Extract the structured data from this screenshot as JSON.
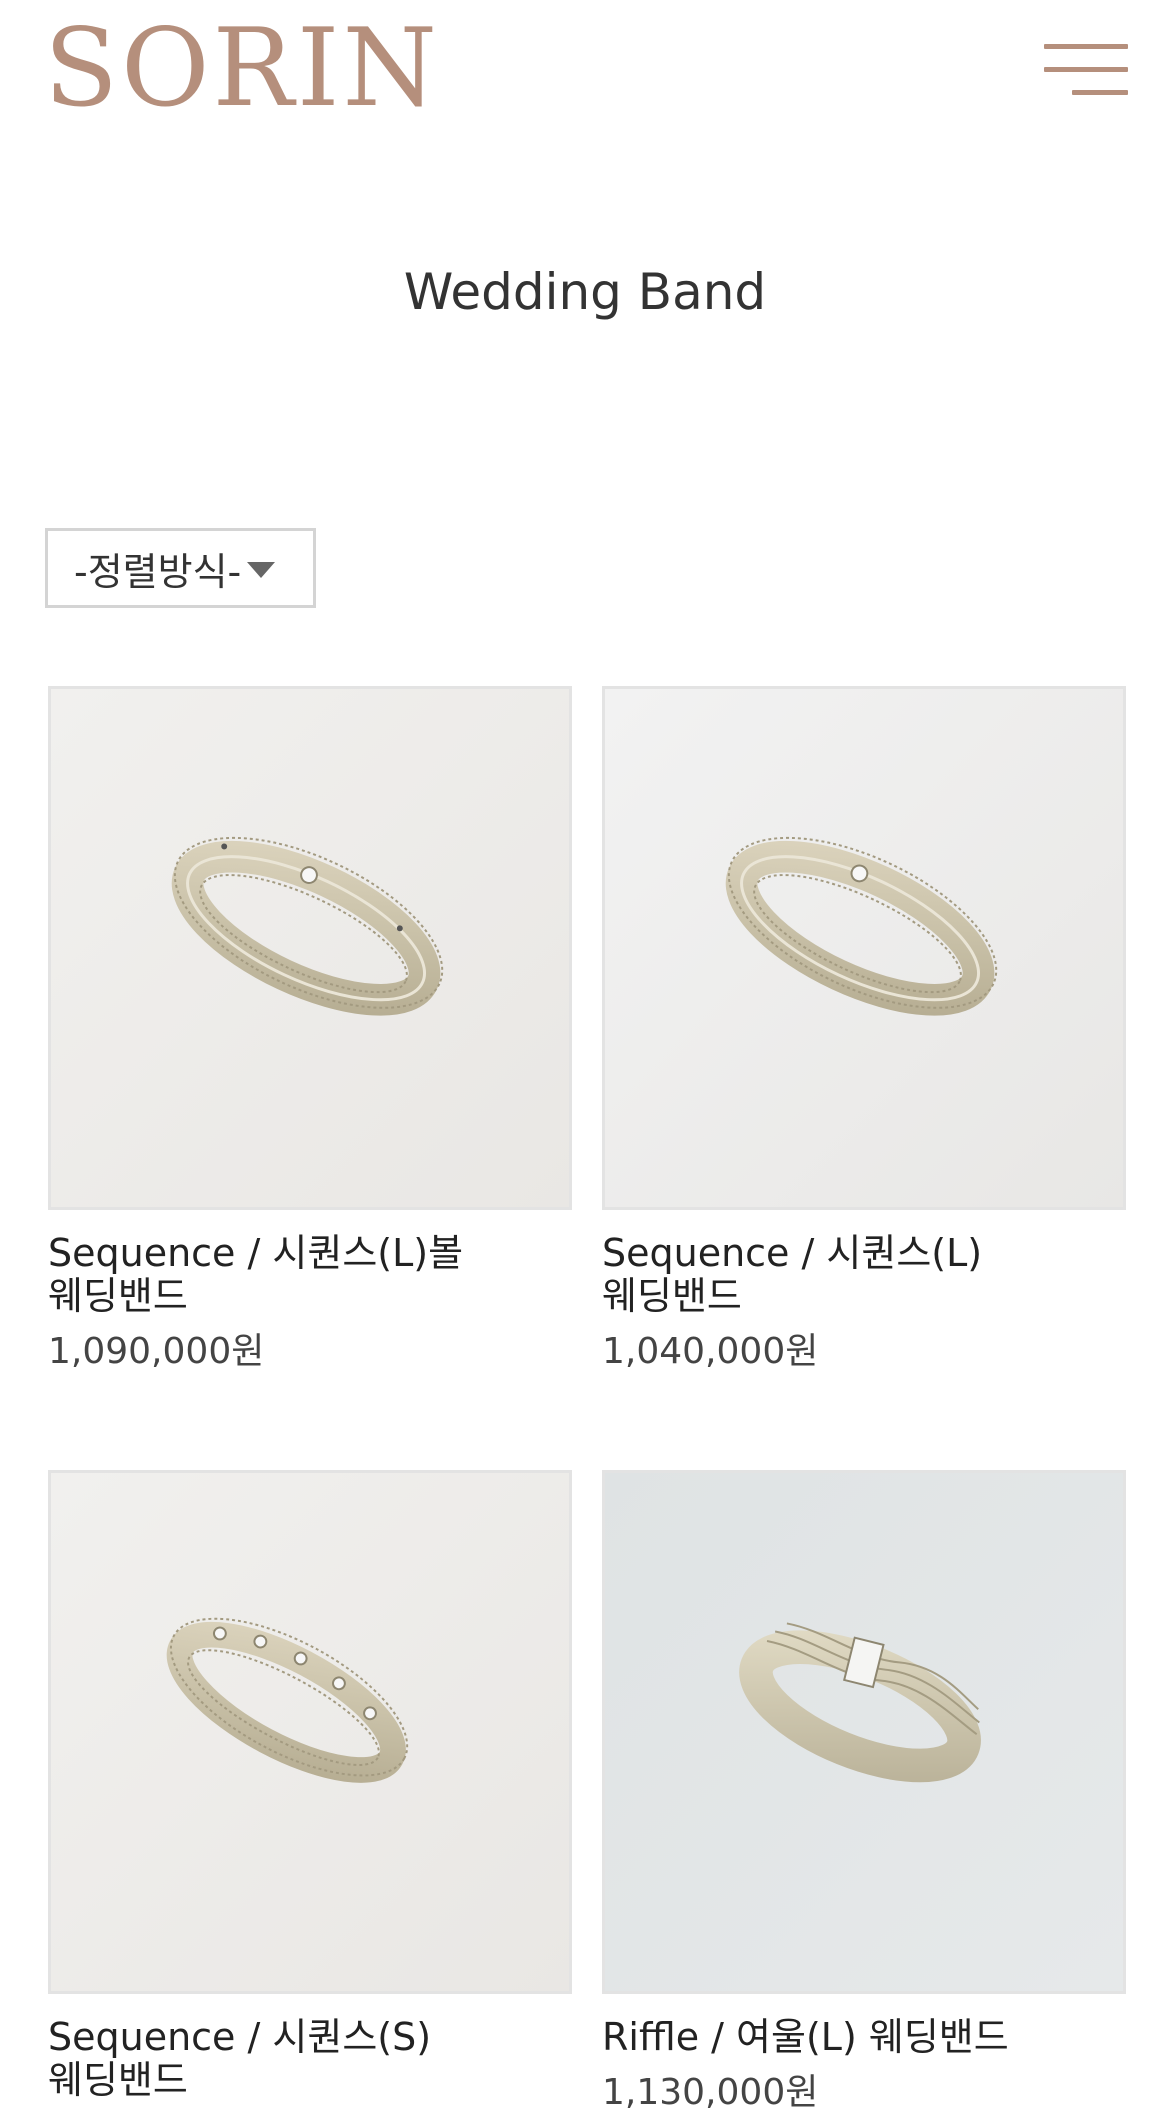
{
  "header": {
    "logo": "SORIN",
    "menu_icon": "hamburger-menu-icon"
  },
  "page_title": "Wedding Band",
  "sort": {
    "label": "-정렬방식-"
  },
  "products": [
    {
      "name": "Sequence / 시퀀스(L)볼 웨딩밴드",
      "price": "1,090,000원"
    },
    {
      "name": "Sequence / 시퀀스(L) 웨딩밴드",
      "price": "1,040,000원"
    },
    {
      "name": "Sequence / 시퀀스(S) 웨딩밴드",
      "price": ""
    },
    {
      "name": "Riffle / 여울(L) 웨딩밴드",
      "price": "1,130,000원"
    }
  ],
  "colors": {
    "brand": "#b58f7c",
    "border": "#e3e3e3"
  }
}
